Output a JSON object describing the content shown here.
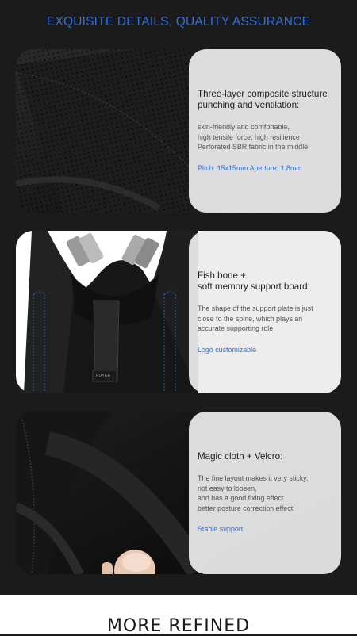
{
  "header": {
    "title": "EXQUISITE DETAILS, QUALITY ASSURANCE"
  },
  "cards": [
    {
      "title_line1": "Three-layer composite structure",
      "title_line2": "punching and ventilation:",
      "body": [
        "skin-friendly and comfortable,",
        "high tensile force, high resilience",
        "Perforated SBR fabric in the middle"
      ],
      "accent": "Pitch: 15x15mm Aperture: 1.8mm"
    },
    {
      "title_line1": "Fish bone +",
      "title_line2": "soft memory support board:",
      "body": [
        "The shape of the support plate is just",
        "close to the spine, which plays an",
        "accurate supporting role"
      ],
      "accent": "Logo customizable",
      "photo_label": "FUYER"
    },
    {
      "title_line1": "Magic cloth + Velcro:",
      "body": [
        "The fine layout makes it very sticky,",
        "not easy to loosen,",
        "and has a good fixing effect.",
        "better posture correction effect"
      ],
      "accent": "Stable support"
    }
  ],
  "footer": {
    "title": "MORE REFINED"
  },
  "colors": {
    "accent": "#2f6fe0",
    "panel": "#ececec",
    "background": "#1b1b1b"
  }
}
